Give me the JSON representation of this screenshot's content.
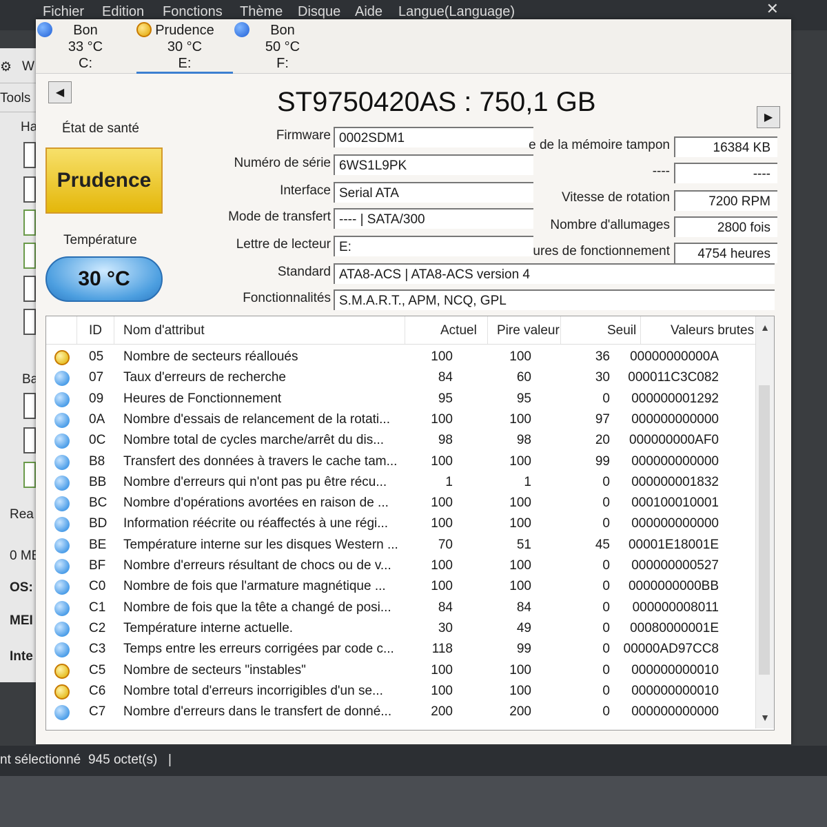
{
  "menu": [
    "Fichier",
    "Edition",
    "Fonctions",
    "Thème",
    "Disque",
    "Aide",
    "Langue(Language)"
  ],
  "close_glyph": "✕",
  "drives": [
    {
      "status": "Bon",
      "temp": "33 °C",
      "letter": "C:",
      "color": "blue"
    },
    {
      "status": "Prudence",
      "temp": "30 °C",
      "letter": "E:",
      "color": "yellow"
    },
    {
      "status": "Bon",
      "temp": "50 °C",
      "letter": "F:",
      "color": "blue"
    }
  ],
  "nav": {
    "prev": "◀",
    "next": "▶"
  },
  "title": "ST9750420AS : 750,1 GB",
  "health": {
    "label": "État de santé",
    "value": "Prudence",
    "temp_label": "Température",
    "temp_value": "30 °C"
  },
  "info_left": [
    {
      "label": "Firmware",
      "value": "0002SDM1"
    },
    {
      "label": "Numéro de série",
      "value": "6WS1L9PK"
    },
    {
      "label": "Interface",
      "value": "Serial ATA"
    },
    {
      "label": "Mode de transfert",
      "value": "---- | SATA/300"
    },
    {
      "label": "Lettre de lecteur",
      "value": "E:"
    },
    {
      "label": "Standard",
      "value": "ATA8-ACS | ATA8-ACS version 4"
    },
    {
      "label": "Fonctionnalités",
      "value": "S.M.A.R.T., APM, NCQ, GPL"
    }
  ],
  "info_right": [
    {
      "label": "e de la mémoire tampon",
      "value": "16384 KB"
    },
    {
      "label": "----",
      "value": "----"
    },
    {
      "label": "Vitesse de rotation",
      "value": "7200 RPM"
    },
    {
      "label": "Nombre d'allumages",
      "value": "2800 fois"
    },
    {
      "label": "ures de fonctionnement",
      "value": "4754 heures"
    }
  ],
  "table": {
    "headers": [
      "ID",
      "Nom d'attribut",
      "Actuel",
      "Pire valeur",
      "Seuil",
      "Valeurs brutes"
    ],
    "rows": [
      {
        "color": "yellow",
        "id": "05",
        "name": "Nombre de secteurs réalloués",
        "actuel": "100",
        "pire": "100",
        "seuil": "36",
        "raw": "00000000000A"
      },
      {
        "color": "blue",
        "id": "07",
        "name": "Taux d'erreurs de recherche",
        "actuel": "84",
        "pire": "60",
        "seuil": "30",
        "raw": "000011C3C082"
      },
      {
        "color": "blue",
        "id": "09",
        "name": "Heures de Fonctionnement",
        "actuel": "95",
        "pire": "95",
        "seuil": "0",
        "raw": "000000001292"
      },
      {
        "color": "blue",
        "id": "0A",
        "name": "Nombre d'essais de relancement de la rotati...",
        "actuel": "100",
        "pire": "100",
        "seuil": "97",
        "raw": "000000000000"
      },
      {
        "color": "blue",
        "id": "0C",
        "name": "Nombre total de cycles marche/arrêt du dis...",
        "actuel": "98",
        "pire": "98",
        "seuil": "20",
        "raw": "000000000AF0"
      },
      {
        "color": "blue",
        "id": "B8",
        "name": "Transfert des données à travers le cache tam...",
        "actuel": "100",
        "pire": "100",
        "seuil": "99",
        "raw": "000000000000"
      },
      {
        "color": "blue",
        "id": "BB",
        "name": "Nombre d'erreurs qui n'ont pas pu être récu...",
        "actuel": "1",
        "pire": "1",
        "seuil": "0",
        "raw": "000000001832"
      },
      {
        "color": "blue",
        "id": "BC",
        "name": "Nombre d'opérations avortées en raison de ...",
        "actuel": "100",
        "pire": "100",
        "seuil": "0",
        "raw": "000100010001"
      },
      {
        "color": "blue",
        "id": "BD",
        "name": "Information réécrite ou réaffectés à une régi...",
        "actuel": "100",
        "pire": "100",
        "seuil": "0",
        "raw": "000000000000"
      },
      {
        "color": "blue",
        "id": "BE",
        "name": "Température interne sur les disques Western ...",
        "actuel": "70",
        "pire": "51",
        "seuil": "45",
        "raw": "00001E18001E"
      },
      {
        "color": "blue",
        "id": "BF",
        "name": "Nombre d'erreurs résultant de chocs ou de v...",
        "actuel": "100",
        "pire": "100",
        "seuil": "0",
        "raw": "000000000527"
      },
      {
        "color": "blue",
        "id": "C0",
        "name": "Nombre de fois que l'armature magnétique ...",
        "actuel": "100",
        "pire": "100",
        "seuil": "0",
        "raw": "0000000000BB"
      },
      {
        "color": "blue",
        "id": "C1",
        "name": "Nombre de fois que la tête a changé de posi...",
        "actuel": "84",
        "pire": "84",
        "seuil": "0",
        "raw": "000000008011"
      },
      {
        "color": "blue",
        "id": "C2",
        "name": "Température interne actuelle.",
        "actuel": "30",
        "pire": "49",
        "seuil": "0",
        "raw": "00080000001E"
      },
      {
        "color": "blue",
        "id": "C3",
        "name": "Temps entre les erreurs corrigées par code c...",
        "actuel": "118",
        "pire": "99",
        "seuil": "0",
        "raw": "00000AD97CC8"
      },
      {
        "color": "yellow",
        "id": "C5",
        "name": "Nombre de secteurs \"instables\"",
        "actuel": "100",
        "pire": "100",
        "seuil": "0",
        "raw": "000000000010"
      },
      {
        "color": "yellow",
        "id": "C6",
        "name": "Nombre total d'erreurs incorrigibles d'un se...",
        "actuel": "100",
        "pire": "100",
        "seuil": "0",
        "raw": "000000000010"
      },
      {
        "color": "blue",
        "id": "C7",
        "name": "Nombre d'erreurs dans le transfert de donné...",
        "actuel": "200",
        "pire": "200",
        "seuil": "0",
        "raw": "000000000000"
      }
    ]
  },
  "background": {
    "labels": [
      "W",
      "Tools",
      "Ha",
      "Ba",
      "Rea",
      "0 MB",
      "OS:",
      "MEI",
      "Inte"
    ]
  },
  "statusbar": {
    "text": "nt sélectionné",
    "size": "945 octet(s)",
    "sep": "|"
  }
}
